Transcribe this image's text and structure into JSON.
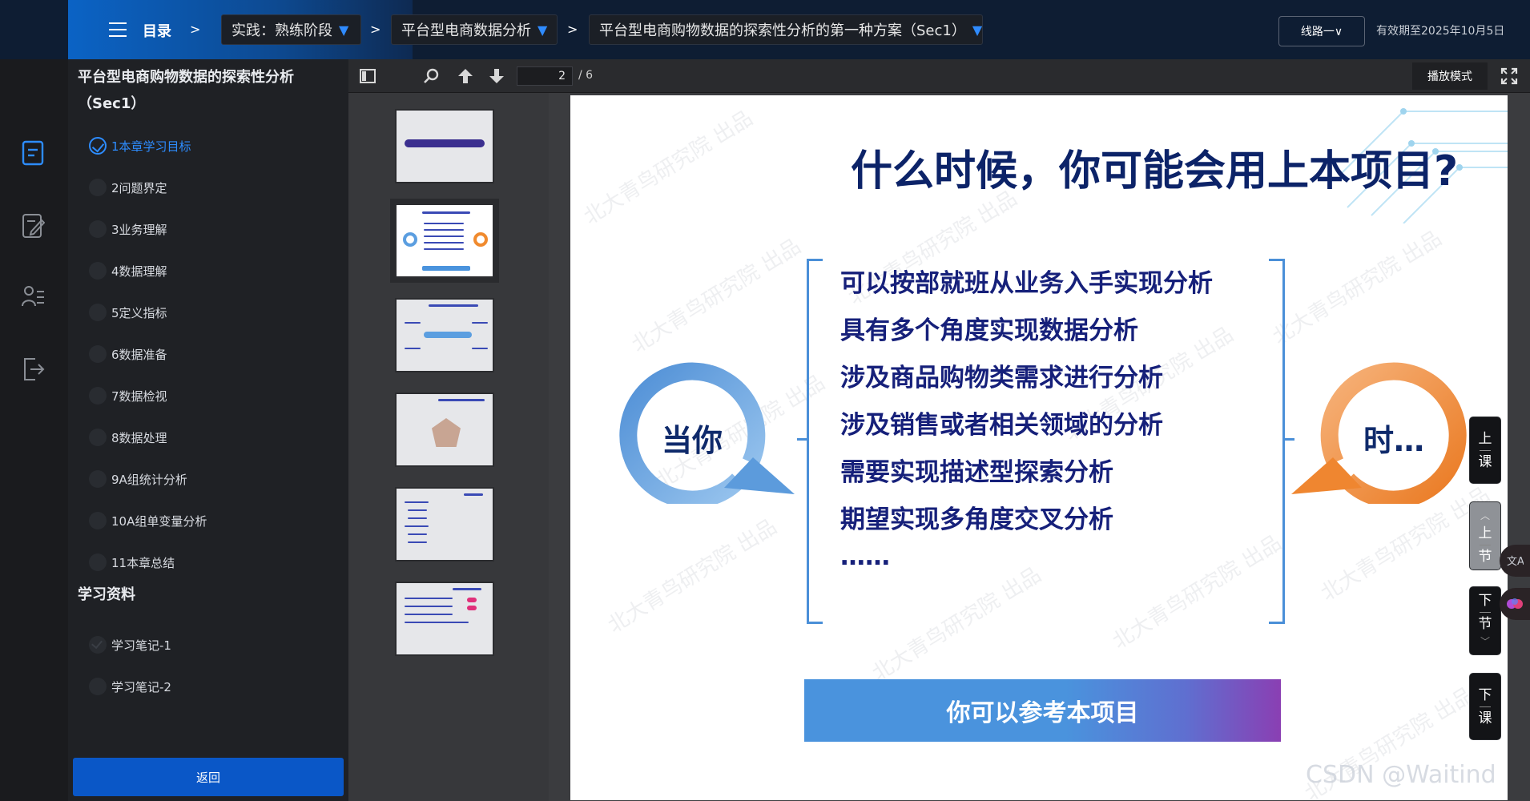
{
  "topbar": {
    "menu_label": "目录",
    "sep": ">",
    "crumbs": [
      "实践：熟练阶段",
      "平台型电商数据分析",
      "平台型电商购物数据的探索性分析的第一种方案（Sec1）"
    ],
    "caret": "▼",
    "route_button": "线路一∨",
    "expiry": "有效期至2025年10月5日"
  },
  "sidebar": {
    "title": "平台型电商购物数据的探索性分析（Sec1）",
    "items": [
      "1本章学习目标",
      "2问题界定",
      "3业务理解",
      "4数据理解",
      "5定义指标",
      "6数据准备",
      "7数据检视",
      "8数据处理",
      "9A组统计分析",
      "10A组单变量分析",
      "11本章总结"
    ],
    "section_title": "学习资料",
    "materials": [
      "学习笔记-1",
      "学习笔记-2"
    ],
    "back_button": "返回"
  },
  "viewer": {
    "page_current": "2",
    "page_total": "/ 6",
    "play_mode": "播放模式",
    "toolbar_icons": [
      "sidebar-toggle-icon",
      "search-icon",
      "arrow-up-icon",
      "arrow-down-icon",
      "fullscreen-icon"
    ]
  },
  "slide": {
    "title": "什么时候，你可能会用上本项目?",
    "bullets": [
      "可以按部就班从业务入手实现分析",
      "具有多个角度实现数据分析",
      "涉及商品购物类需求进行分析",
      "涉及销售或者相关领域的分析",
      "需要实现描述型探索分析",
      "期望实现多角度交叉分析",
      "……"
    ],
    "left_label": "当你",
    "right_label": "时…",
    "cta": "你可以参考本项目",
    "watermark": "北大青鸟研究院 出品",
    "colors": {
      "title": "#0c2368",
      "bullet": "#16207a",
      "ring_blue": "#5b9ee0",
      "ring_orange": "#f08a2e"
    }
  },
  "sidenav": {
    "prev_lesson": [
      "上",
      "课"
    ],
    "prev_section": [
      "上",
      "节"
    ],
    "next_section": [
      "下",
      "节"
    ],
    "next_lesson": [
      "下",
      "课"
    ]
  },
  "watermark_csdn": "CSDN @Waitind"
}
